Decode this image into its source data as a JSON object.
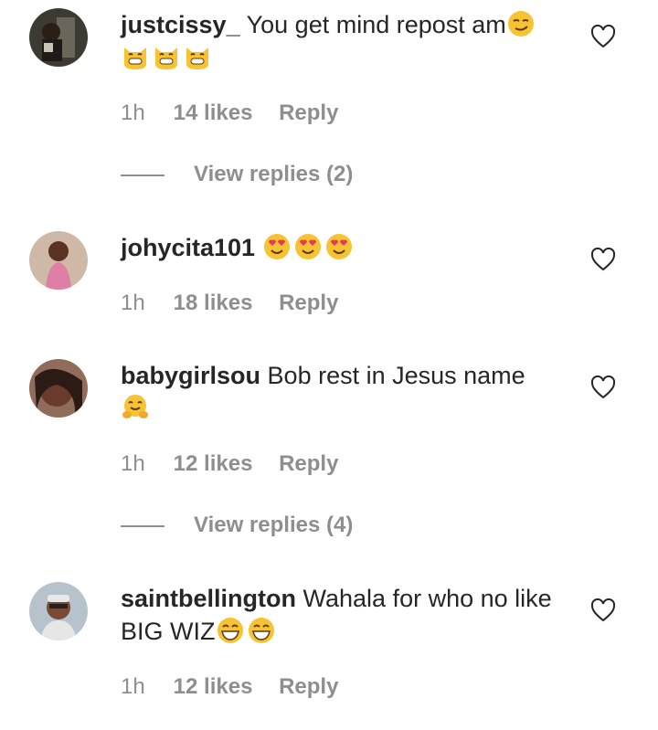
{
  "comments": [
    {
      "username": "justcissy_",
      "text": "You get mind repost am",
      "emojis": [
        "smirk-face",
        "grinning-cat",
        "grinning-cat",
        "grinning-cat"
      ],
      "time": "1h",
      "likes": "14 likes",
      "reply": "Reply",
      "view_replies": "View replies (2)"
    },
    {
      "username": "johycita101",
      "text": "",
      "emojis": [
        "heart-eyes-face",
        "heart-eyes-face",
        "heart-eyes-face"
      ],
      "time": "1h",
      "likes": "18 likes",
      "reply": "Reply"
    },
    {
      "username": "babygirlsou",
      "text": "Bob rest in Jesus name",
      "emojis": [
        "hugging-face"
      ],
      "time": "1h",
      "likes": "12 likes",
      "reply": "Reply",
      "view_replies": "View replies (4)"
    },
    {
      "username": "saintbellington",
      "text": "Wahala for who no like BIG WIZ",
      "emojis": [
        "grinning-face",
        "grinning-face"
      ],
      "time": "1h",
      "likes": "12 likes",
      "reply": "Reply"
    }
  ],
  "colors": {
    "text": "#262626",
    "secondary": "#8e8e8e",
    "emoji": "#f7c332"
  }
}
